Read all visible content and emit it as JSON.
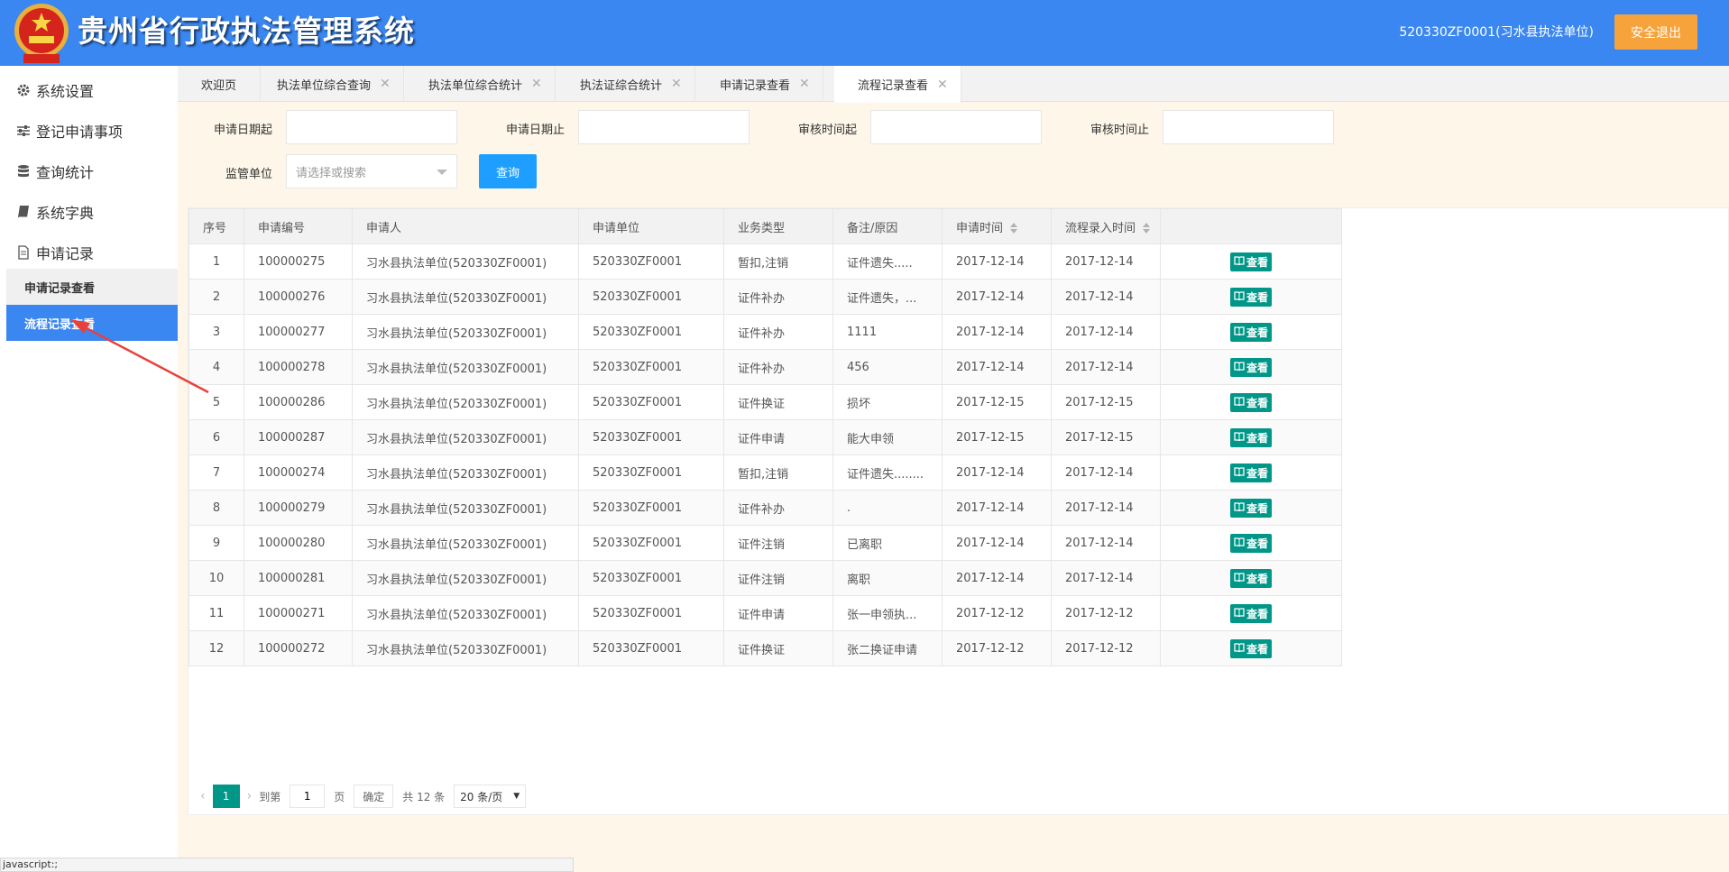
{
  "header": {
    "title": "贵州省行政执法管理系统",
    "user": "520330ZF0001(习水县执法单位)",
    "logout": "安全退出"
  },
  "sidebar": {
    "items": [
      {
        "label": "系统设置",
        "icon": "gear-icon"
      },
      {
        "label": "登记申请事项",
        "icon": "sliders-icon"
      },
      {
        "label": "查询统计",
        "icon": "database-icon"
      },
      {
        "label": "系统字典",
        "icon": "book-icon"
      },
      {
        "label": "申请记录",
        "icon": "document-icon"
      }
    ],
    "sub": [
      {
        "label": "申请记录查看",
        "active": false
      },
      {
        "label": "流程记录查看",
        "active": true
      }
    ]
  },
  "tabs": [
    {
      "label": "欢迎页"
    },
    {
      "label": "执法单位综合查询"
    },
    {
      "label": "执法单位综合统计"
    },
    {
      "label": "执法证综合统计"
    },
    {
      "label": "申请记录查看"
    },
    {
      "label": "流程记录查看"
    }
  ],
  "filters": {
    "apply_date_from": "申请日期起",
    "apply_date_to": "申请日期止",
    "review_time_from": "审核时间起",
    "review_time_to": "审核时间止",
    "supervisor_unit": "监管单位",
    "supervisor_placeholder": "请选择或搜索",
    "query": "查询"
  },
  "table": {
    "columns": [
      "序号",
      "申请编号",
      "申请人",
      "申请单位",
      "业务类型",
      "备注/原因",
      "申请时间",
      "流程录入时间"
    ],
    "view_label": "查看",
    "rows": [
      [
        "1",
        "100000275",
        "习水县执法单位(520330ZF0001)",
        "520330ZF0001",
        "暂扣,注销",
        "证件遗失.....",
        "2017-12-14",
        "2017-12-14"
      ],
      [
        "2",
        "100000276",
        "习水县执法单位(520330ZF0001)",
        "520330ZF0001",
        "证件补办",
        "证件遗失，...",
        "2017-12-14",
        "2017-12-14"
      ],
      [
        "3",
        "100000277",
        "习水县执法单位(520330ZF0001)",
        "520330ZF0001",
        "证件补办",
        "1111",
        "2017-12-14",
        "2017-12-14"
      ],
      [
        "4",
        "100000278",
        "习水县执法单位(520330ZF0001)",
        "520330ZF0001",
        "证件补办",
        "456",
        "2017-12-14",
        "2017-12-14"
      ],
      [
        "5",
        "100000286",
        "习水县执法单位(520330ZF0001)",
        "520330ZF0001",
        "证件换证",
        "损坏",
        "2017-12-15",
        "2017-12-15"
      ],
      [
        "6",
        "100000287",
        "习水县执法单位(520330ZF0001)",
        "520330ZF0001",
        "证件申请",
        "能大申领",
        "2017-12-15",
        "2017-12-15"
      ],
      [
        "7",
        "100000274",
        "习水县执法单位(520330ZF0001)",
        "520330ZF0001",
        "暂扣,注销",
        "证件遗失........",
        "2017-12-14",
        "2017-12-14"
      ],
      [
        "8",
        "100000279",
        "习水县执法单位(520330ZF0001)",
        "520330ZF0001",
        "证件补办",
        ".",
        "2017-12-14",
        "2017-12-14"
      ],
      [
        "9",
        "100000280",
        "习水县执法单位(520330ZF0001)",
        "520330ZF0001",
        "证件注销",
        "已离职",
        "2017-12-14",
        "2017-12-14"
      ],
      [
        "10",
        "100000281",
        "习水县执法单位(520330ZF0001)",
        "520330ZF0001",
        "证件注销",
        "离职",
        "2017-12-14",
        "2017-12-14"
      ],
      [
        "11",
        "100000271",
        "习水县执法单位(520330ZF0001)",
        "520330ZF0001",
        "证件申请",
        "张一申领执...",
        "2017-12-12",
        "2017-12-12"
      ],
      [
        "12",
        "100000272",
        "习水县执法单位(520330ZF0001)",
        "520330ZF0001",
        "证件换证",
        "张二换证申请",
        "2017-12-12",
        "2017-12-12"
      ]
    ]
  },
  "pager": {
    "current": "1",
    "goto": "到第",
    "page_input": "1",
    "page_unit": "页",
    "confirm": "确定",
    "total": "共 12 条",
    "per_page": "20 条/页"
  },
  "status_text": "javascript:;",
  "colors": {
    "header": "#3a87f2",
    "logout": "#f7a33c",
    "query": "#1e9fff",
    "view": "#009688",
    "arrow": "#e8413b"
  }
}
